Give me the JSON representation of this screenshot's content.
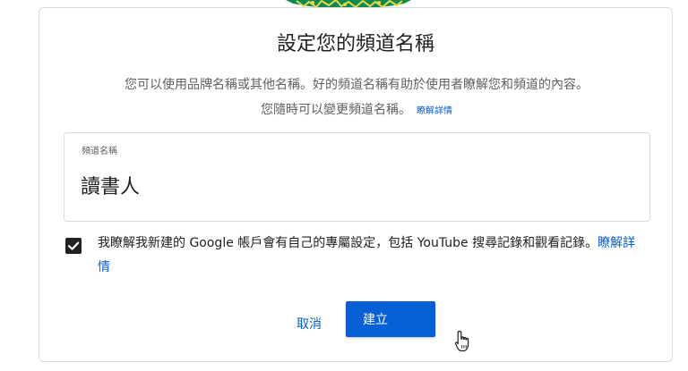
{
  "dialog": {
    "title": "設定您的頻道名稱",
    "description_line1": "您可以使用品牌名稱或其他名稱。好的頻道名稱有助於使用者瞭解您和頻道的內容。",
    "description_line2": "您隨時可以變更頻道名稱。",
    "learn_more": "瞭解詳情"
  },
  "channel_name_field": {
    "label": "頻道名稱",
    "value": "讀書人"
  },
  "consent": {
    "checked": true,
    "text": "我瞭解我新建的 Google 帳戶會有自己的專屬設定，包括 YouTube 搜尋記錄和觀看記錄。",
    "link": "瞭解詳情"
  },
  "buttons": {
    "cancel": "取消",
    "create": "建立"
  },
  "colors": {
    "accent_blue": "#065fd4",
    "avatar_green": "#0f8a4f",
    "avatar_yellow": "#e8d84a",
    "checkbox_fill": "#202124"
  },
  "icons": {
    "checkbox": "check-icon",
    "pointer": "hand-pointer-icon"
  }
}
